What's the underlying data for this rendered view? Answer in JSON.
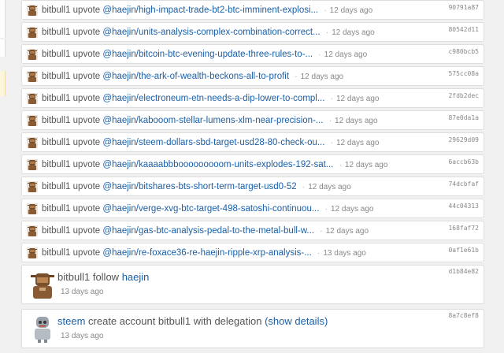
{
  "colors": {
    "link": "#1a5fa8",
    "text": "#555555",
    "muted": "#888888",
    "background": "#f0f0f0"
  },
  "activity": [
    {
      "user": "bitbull1",
      "action": "upvote",
      "target": "@haejin/high-impact-trade-bt2-btc-imminent-explosi...",
      "time": "12 days ago",
      "hash": "90791a87"
    },
    {
      "user": "bitbull1",
      "action": "upvote",
      "target": "@haejin/units-analysis-complex-combination-correct...",
      "time": "12 days ago",
      "hash": "80542d11"
    },
    {
      "user": "bitbull1",
      "action": "upvote",
      "target": "@haejin/bitcoin-btc-evening-update-three-rules-to-...",
      "time": "12 days ago",
      "hash": "c980bcb5"
    },
    {
      "user": "bitbull1",
      "action": "upvote",
      "target": "@haejin/the-ark-of-wealth-beckons-all-to-profit",
      "time": "12 days ago",
      "hash": "575cc08a"
    },
    {
      "user": "bitbull1",
      "action": "upvote",
      "target": "@haejin/electroneum-etn-needs-a-dip-lower-to-compl...",
      "time": "12 days ago",
      "hash": "2fdb2dec"
    },
    {
      "user": "bitbull1",
      "action": "upvote",
      "target": "@haejin/kabooom-stellar-lumens-xlm-near-precision-...",
      "time": "12 days ago",
      "hash": "87e0da1a"
    },
    {
      "user": "bitbull1",
      "action": "upvote",
      "target": "@haejin/steem-dollars-sbd-target-usd28-80-check-ou...",
      "time": "12 days ago",
      "hash": "29629d09"
    },
    {
      "user": "bitbull1",
      "action": "upvote",
      "target": "@haejin/kaaaabbbooooooooom-units-explodes-192-sat...",
      "time": "12 days ago",
      "hash": "6accb63b"
    },
    {
      "user": "bitbull1",
      "action": "upvote",
      "target": "@haejin/bitshares-bts-short-term-target-usd0-52",
      "time": "12 days ago",
      "hash": "74dcbfaf"
    },
    {
      "user": "bitbull1",
      "action": "upvote",
      "target": "@haejin/verge-xvg-btc-target-498-satoshi-continuou...",
      "time": "12 days ago",
      "hash": "44c04313"
    },
    {
      "user": "bitbull1",
      "action": "upvote",
      "target": "@haejin/gas-btc-analysis-pedal-to-the-metal-bull-w...",
      "time": "12 days ago",
      "hash": "168faf72"
    },
    {
      "user": "bitbull1",
      "action": "upvote",
      "target": "@haejin/re-foxace36-re-haejin-ripple-xrp-analysis-...",
      "time": "13 days ago",
      "hash": "0af1e61b"
    }
  ],
  "follow": {
    "user": "bitbull1",
    "action": "follow",
    "target": "haejin",
    "time": "13 days ago",
    "hash": "d1b84e82"
  },
  "create": {
    "user": "steem",
    "action_text": "create account bitbull1 with delegation",
    "details_link": "(show details)",
    "time": "13 days ago",
    "hash": "8a7c8ef8"
  },
  "icons": {
    "user_avatar": "bitbull-avatar-icon",
    "steem_avatar": "robot-avatar-icon"
  }
}
